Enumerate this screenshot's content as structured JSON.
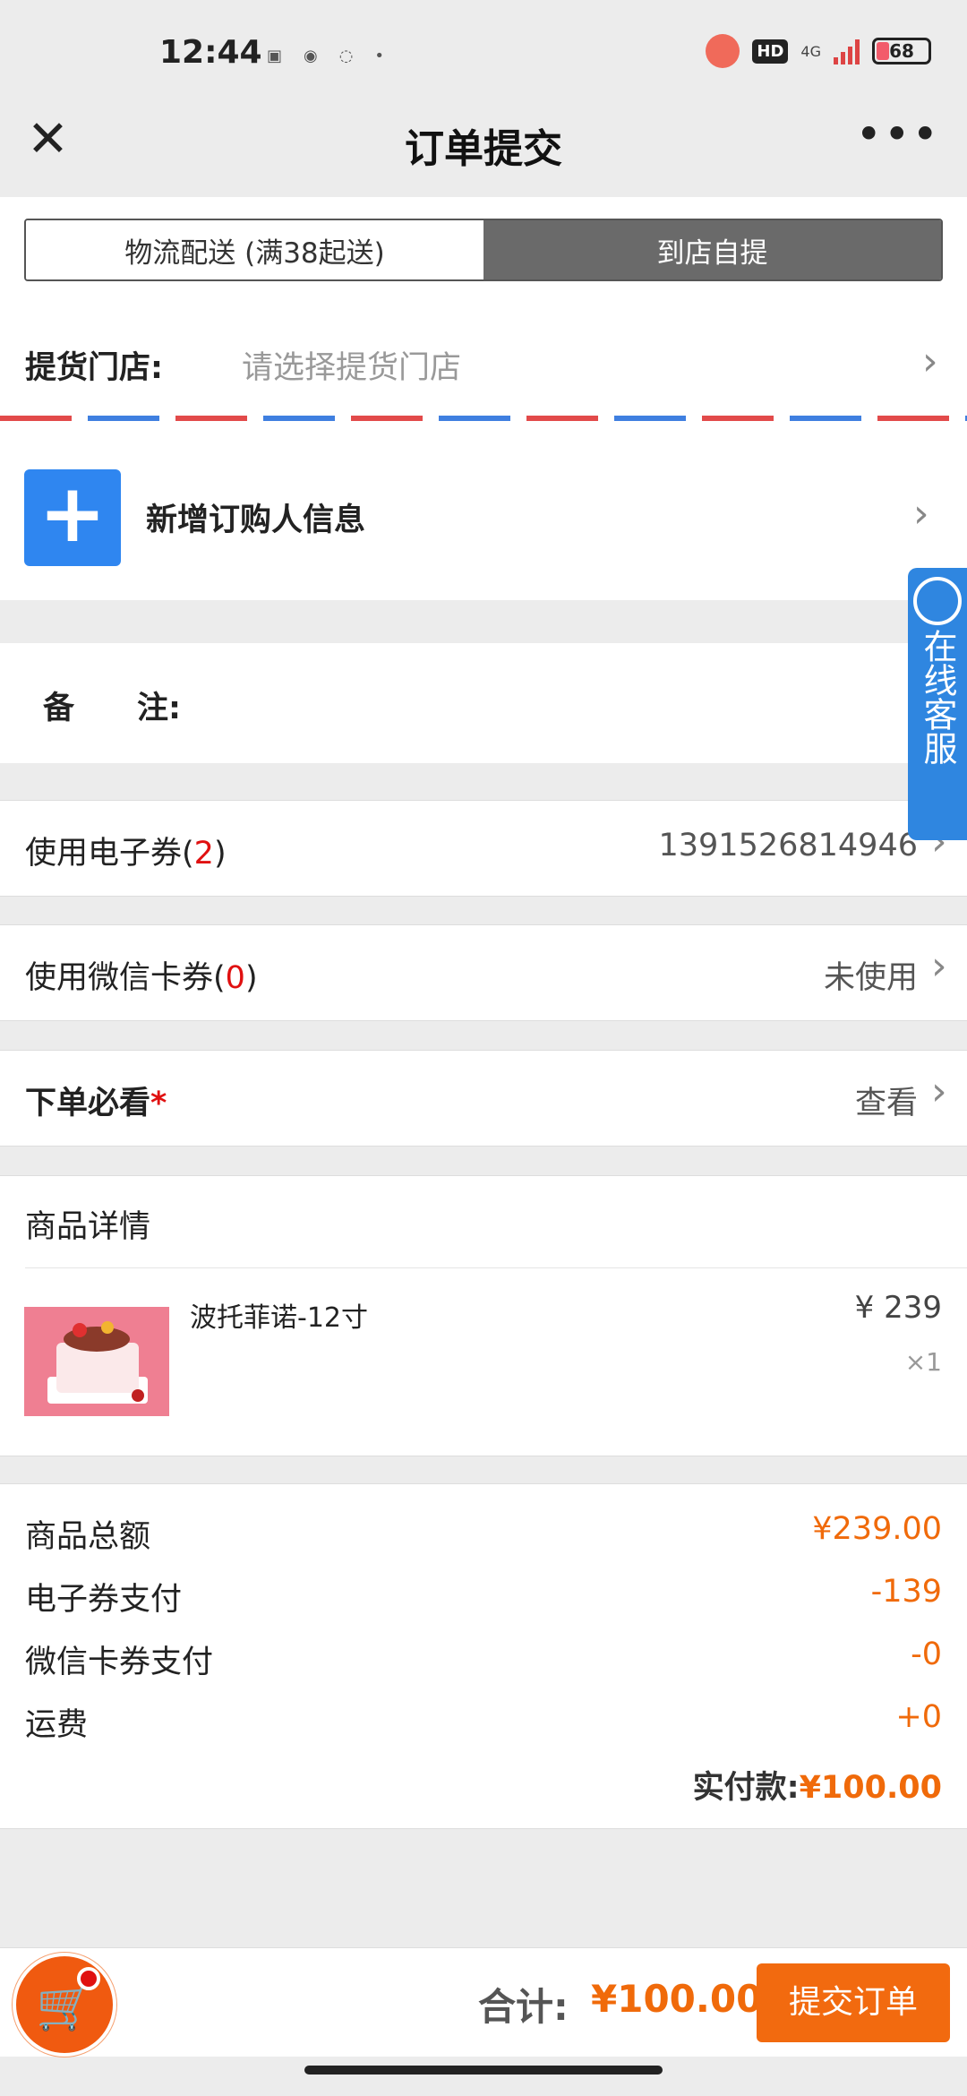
{
  "status": {
    "time": "12:44",
    "signal": "4G",
    "battery": "68",
    "hd": "HD"
  },
  "nav": {
    "title": "订单提交"
  },
  "delivery": {
    "tab_logistics": "物流配送 (满38起送)",
    "tab_pickup": "到店自提",
    "active": "到店自提"
  },
  "store": {
    "label": "提货门店:",
    "placeholder": "请选择提货门店"
  },
  "buyer": {
    "label": "新增订购人信息"
  },
  "remark": {
    "label": "备　　注:"
  },
  "coupon": {
    "label": "使用电子券(",
    "count": "2",
    "close": ")",
    "value": "1391526814946"
  },
  "wechat_card": {
    "label": "使用微信卡券(",
    "count": "0",
    "close": ")",
    "value": "未使用"
  },
  "notice": {
    "label": "下单必看",
    "star": "*",
    "value": "查看"
  },
  "goods": {
    "section_title": "商品详情",
    "items": [
      {
        "name": "波托菲诺-12寸",
        "price": "¥ 239",
        "qty": "×1"
      }
    ]
  },
  "summary": {
    "rows": [
      {
        "label": "商品总额",
        "value": "¥239.00"
      },
      {
        "label": "电子券支付",
        "value": "-139"
      },
      {
        "label": "微信卡券支付",
        "value": "-0"
      },
      {
        "label": "运费",
        "value": "+0"
      }
    ],
    "paid_label": "实付款:",
    "paid_value": "¥100.00"
  },
  "side_service": {
    "label": "在线客服"
  },
  "bottom": {
    "total_label": "合计:",
    "total_value": "¥100.00",
    "submit_label": "提交订单"
  },
  "colors": {
    "accent": "#f26a0f",
    "blue": "#2f86f0",
    "active_tab": "#6a6a6a"
  }
}
